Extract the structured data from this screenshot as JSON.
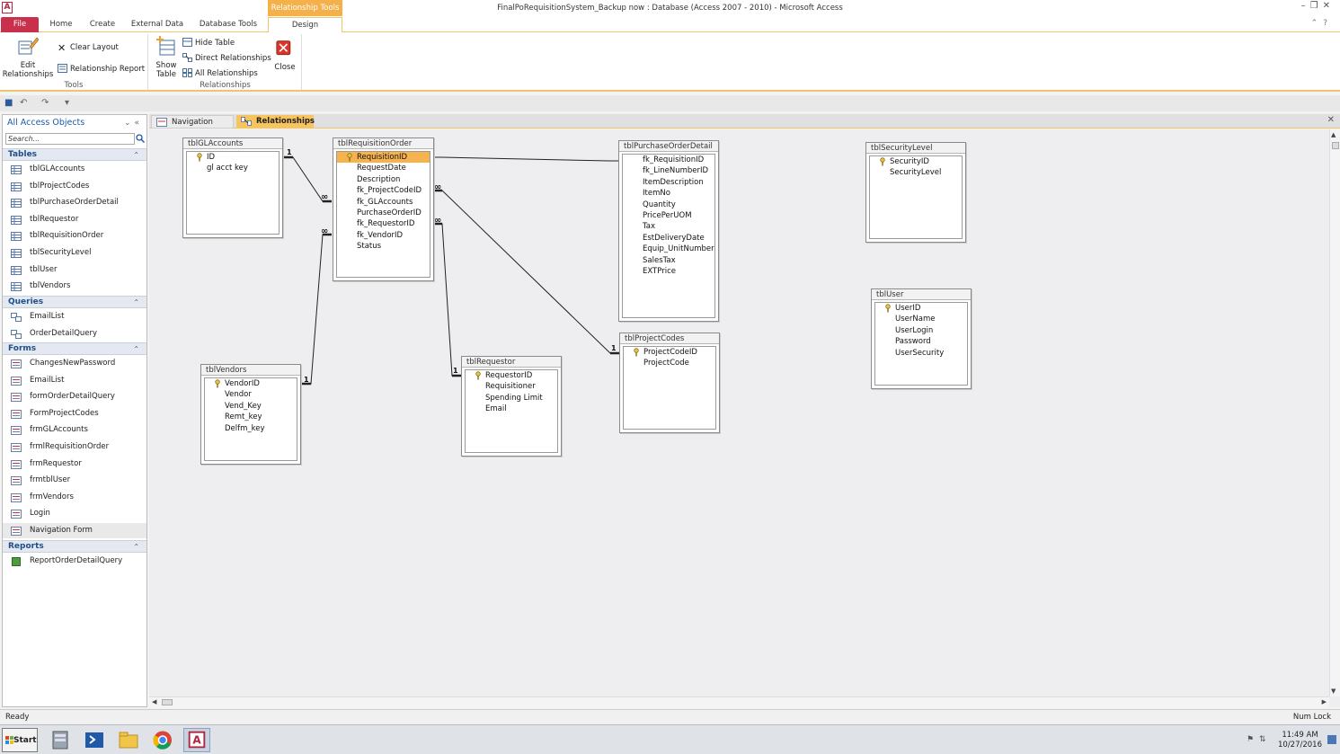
{
  "window": {
    "title": "FinalPoRequisitionSystem_Backup now : Database (Access 2007 - 2010)  -  Microsoft Access",
    "context_tab_group": "Relationship Tools",
    "app_icon_letter": "A"
  },
  "ribbon": {
    "tabs": [
      "File",
      "Home",
      "Create",
      "External Data",
      "Database Tools",
      "Design"
    ],
    "tools_group": {
      "label": "Tools",
      "edit_relationships": "Edit Relationships",
      "clear_layout": "Clear Layout",
      "relationship_report": "Relationship Report"
    },
    "relationships_group": {
      "label": "Relationships",
      "show_table": "Show Table",
      "hide_table": "Hide Table",
      "direct_relationships": "Direct Relationships",
      "all_relationships": "All Relationships",
      "close": "Close"
    }
  },
  "nav_pane": {
    "header": "All Access Objects",
    "search_placeholder": "Search...",
    "sections": [
      {
        "title": "Tables",
        "items": [
          "tblGLAccounts",
          "tblProjectCodes",
          "tblPurchaseOrderDetail",
          "tblRequestor",
          "tblRequisitionOrder",
          "tblSecurityLevel",
          "tblUser",
          "tblVendors"
        ]
      },
      {
        "title": "Queries",
        "items": [
          "EmailList",
          "OrderDetailQuery"
        ]
      },
      {
        "title": "Forms",
        "items": [
          "ChangesNewPassword",
          "EmailList",
          "formOrderDetailQuery",
          "FormProjectCodes",
          "frmGLAccounts",
          "frmlRequisitionOrder",
          "frmRequestor",
          "frmtblUser",
          "frmVendors",
          "Login",
          "Navigation Form"
        ]
      },
      {
        "title": "Reports",
        "items": [
          "ReportOrderDetailQuery"
        ]
      }
    ]
  },
  "doc_tabs": [
    "Navigation Form",
    "Relationships"
  ],
  "tables": [
    {
      "name": "tblGLAccounts",
      "fields": [
        "ID",
        "gl acct key"
      ],
      "keys": [
        0
      ]
    },
    {
      "name": "tblRequisitionOrder",
      "fields": [
        "RequisitionID",
        "RequestDate",
        "Description",
        "fk_ProjectCodeID",
        "fk_GLAccounts",
        "PurchaseOrderID",
        "fk_RequestorID",
        "fk_VendorID",
        "Status"
      ],
      "keys": [
        0
      ]
    },
    {
      "name": "tblPurchaseOrderDetail",
      "fields": [
        "fk_RequisitionID",
        "fk_LineNumberID",
        "ItemDescription",
        "ItemNo",
        "Quantity",
        "PricePerUOM",
        "Tax",
        "EstDeliveryDate",
        "Equip_UnitNumber",
        "SalesTax",
        "EXTPrice"
      ],
      "keys": []
    },
    {
      "name": "tblSecurityLevel",
      "fields": [
        "SecurityID",
        "SecurityLevel"
      ],
      "keys": [
        0
      ]
    },
    {
      "name": "tblVendors",
      "fields": [
        "VendorID",
        "Vendor",
        "Vend_Key",
        "Remt_key",
        "Delfm_key"
      ],
      "keys": [
        0
      ]
    },
    {
      "name": "tblRequestor",
      "fields": [
        "RequestorID",
        "Requisitioner",
        "Spending Limit",
        "Email"
      ],
      "keys": [
        0
      ]
    },
    {
      "name": "tblProjectCodes",
      "fields": [
        "ProjectCodeID",
        "ProjectCode"
      ],
      "keys": [
        0
      ]
    },
    {
      "name": "tblUser",
      "fields": [
        "UserID",
        "UserName",
        "UserLogin",
        "Password",
        "UserSecurity"
      ],
      "keys": [
        0
      ]
    }
  ],
  "relationship_labels": {
    "one": "1",
    "many": "∞"
  },
  "status": {
    "left": "Ready",
    "right": "Num Lock"
  },
  "taskbar": {
    "start": "Start",
    "time": "11:49 AM",
    "date": "10/27/2016"
  },
  "colors": {
    "accent": "#f6b24e",
    "file_tab": "#c8304c"
  }
}
